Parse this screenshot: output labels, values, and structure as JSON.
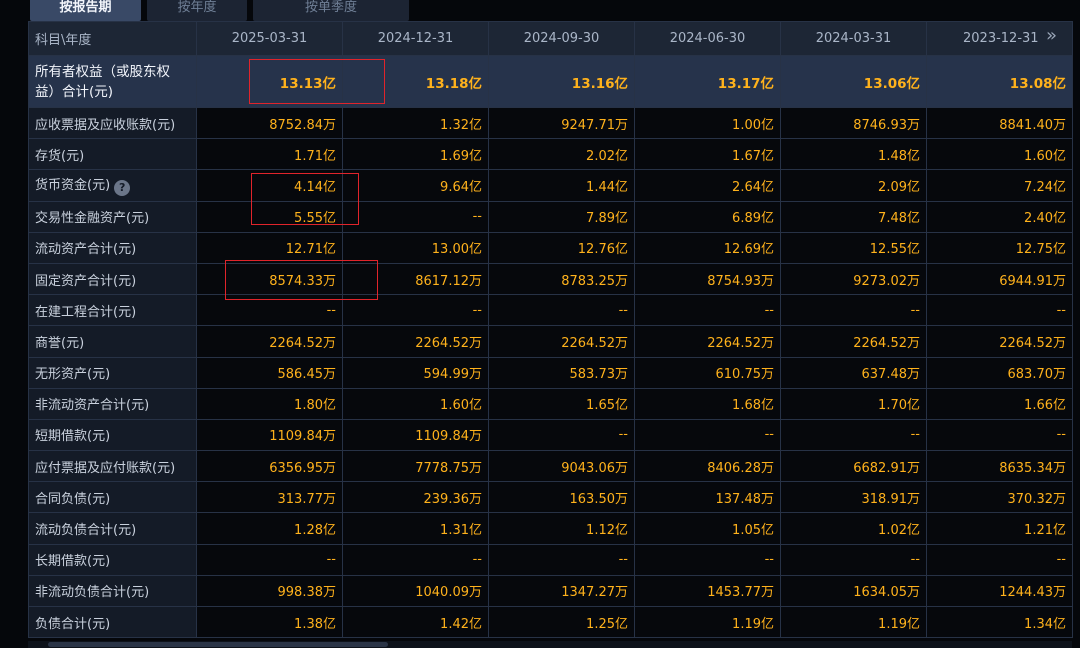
{
  "tabs": [
    {
      "label": "按报告期",
      "active": true
    },
    {
      "label": "按年度",
      "active": false
    },
    {
      "label": "按单季度",
      "active": false
    }
  ],
  "table": {
    "corner_label": "科目\\年度",
    "periods": [
      "2025-03-31",
      "2024-12-31",
      "2024-09-30",
      "2024-06-30",
      "2024-03-31",
      "2023-12-31"
    ],
    "rows": [
      {
        "label": "所有者权益（或股东权益）合计(元)",
        "values": [
          "13.13亿",
          "13.18亿",
          "13.16亿",
          "13.17亿",
          "13.06亿",
          "13.08亿"
        ]
      },
      {
        "label": "应收票据及应收账款(元)",
        "values": [
          "8752.84万",
          "1.32亿",
          "9247.71万",
          "1.00亿",
          "8746.93万",
          "8841.40万"
        ]
      },
      {
        "label": "存货(元)",
        "values": [
          "1.71亿",
          "1.69亿",
          "2.02亿",
          "1.67亿",
          "1.48亿",
          "1.60亿"
        ]
      },
      {
        "label": "货币资金(元)",
        "values": [
          "4.14亿",
          "9.64亿",
          "1.44亿",
          "2.64亿",
          "2.09亿",
          "7.24亿"
        ]
      },
      {
        "label": "交易性金融资产(元)",
        "values": [
          "5.55亿",
          "--",
          "7.89亿",
          "6.89亿",
          "7.48亿",
          "2.40亿"
        ]
      },
      {
        "label": "流动资产合计(元)",
        "values": [
          "12.71亿",
          "13.00亿",
          "12.76亿",
          "12.69亿",
          "12.55亿",
          "12.75亿"
        ]
      },
      {
        "label": "固定资产合计(元)",
        "values": [
          "8574.33万",
          "8617.12万",
          "8783.25万",
          "8754.93万",
          "9273.02万",
          "6944.91万"
        ]
      },
      {
        "label": "在建工程合计(元)",
        "values": [
          "--",
          "--",
          "--",
          "--",
          "--",
          "--"
        ]
      },
      {
        "label": "商誉(元)",
        "values": [
          "2264.52万",
          "2264.52万",
          "2264.52万",
          "2264.52万",
          "2264.52万",
          "2264.52万"
        ]
      },
      {
        "label": "无形资产(元)",
        "values": [
          "586.45万",
          "594.99万",
          "583.73万",
          "610.75万",
          "637.48万",
          "683.70万"
        ]
      },
      {
        "label": "非流动资产合计(元)",
        "values": [
          "1.80亿",
          "1.60亿",
          "1.65亿",
          "1.68亿",
          "1.70亿",
          "1.66亿"
        ]
      },
      {
        "label": "短期借款(元)",
        "values": [
          "1109.84万",
          "1109.84万",
          "--",
          "--",
          "--",
          "--"
        ]
      },
      {
        "label": "应付票据及应付账款(元)",
        "values": [
          "6356.95万",
          "7778.75万",
          "9043.06万",
          "8406.28万",
          "6682.91万",
          "8635.34万"
        ]
      },
      {
        "label": "合同负债(元)",
        "values": [
          "313.77万",
          "239.36万",
          "163.50万",
          "137.48万",
          "318.91万",
          "370.32万"
        ]
      },
      {
        "label": "流动负债合计(元)",
        "values": [
          "1.28亿",
          "1.31亿",
          "1.12亿",
          "1.05亿",
          "1.02亿",
          "1.21亿"
        ]
      },
      {
        "label": "长期借款(元)",
        "values": [
          "--",
          "--",
          "--",
          "--",
          "--",
          "--"
        ]
      },
      {
        "label": "非流动负债合计(元)",
        "values": [
          "998.38万",
          "1040.09万",
          "1347.27万",
          "1453.77万",
          "1634.05万",
          "1244.43万"
        ]
      },
      {
        "label": "负债合计(元)",
        "values": [
          "1.38亿",
          "1.42亿",
          "1.25亿",
          "1.19亿",
          "1.19亿",
          "1.34亿"
        ]
      }
    ]
  },
  "icons": {
    "help": "?",
    "more": "»"
  },
  "colors": {
    "value": "#ffb21c",
    "highlight_box": "#e0242b",
    "header_bg": "#1d2635"
  }
}
